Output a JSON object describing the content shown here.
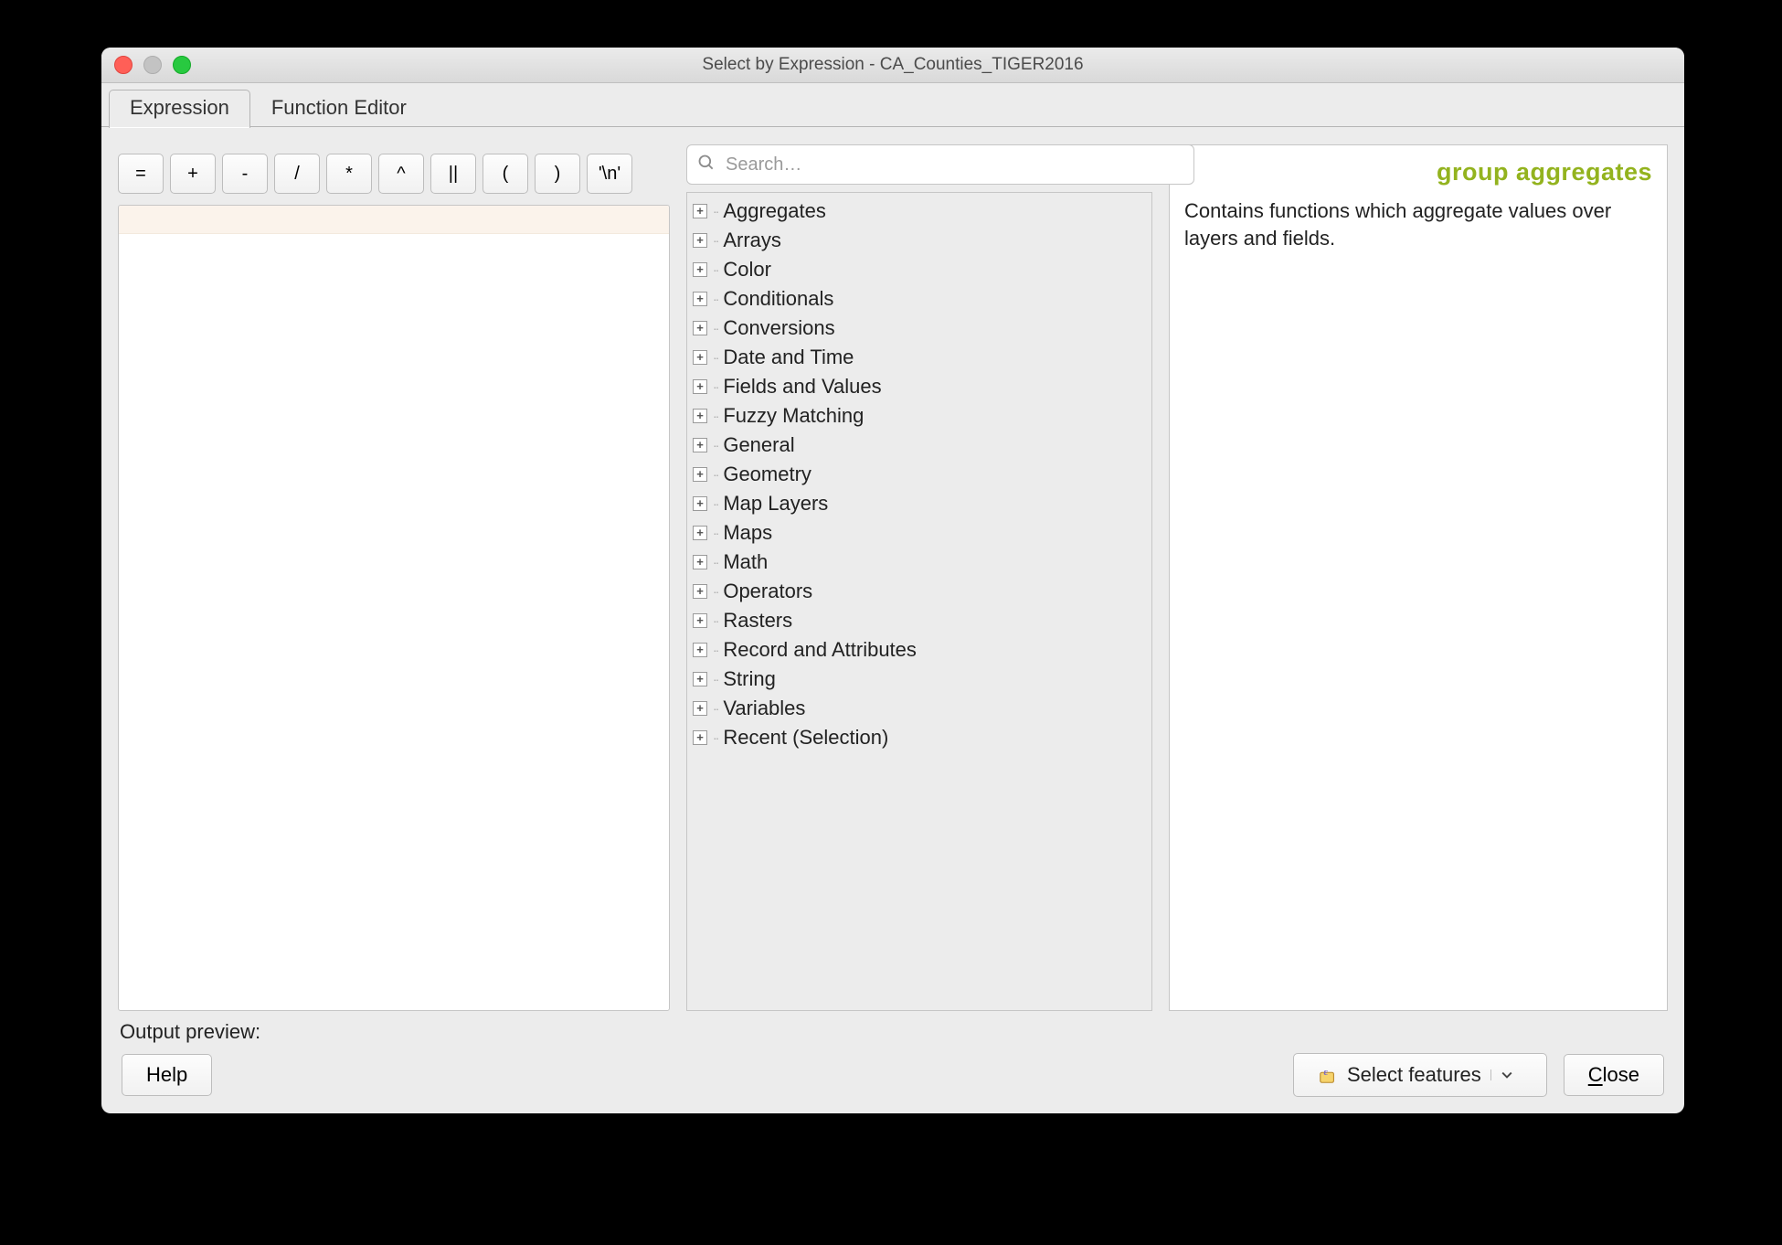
{
  "title": "Select by Expression - CA_Counties_TIGER2016",
  "tabs": {
    "expression": "Expression",
    "functionEditor": "Function Editor"
  },
  "operators": [
    "=",
    "+",
    "-",
    "/",
    "*",
    "^",
    "||",
    "(",
    ")",
    "'\\n'"
  ],
  "search": {
    "placeholder": "Search…",
    "value": ""
  },
  "categories": [
    "Aggregates",
    "Arrays",
    "Color",
    "Conditionals",
    "Conversions",
    "Date and Time",
    "Fields and Values",
    "Fuzzy Matching",
    "General",
    "Geometry",
    "Map Layers",
    "Maps",
    "Math",
    "Operators",
    "Rasters",
    "Record and Attributes",
    "String",
    "Variables",
    "Recent (Selection)"
  ],
  "help": {
    "title": "group aggregates",
    "body": "Contains functions which aggregate values over layers and fields."
  },
  "previewLabel": "Output preview:",
  "buttons": {
    "help": "Help",
    "select": "Select features",
    "close_prefix": "C",
    "close_rest": "lose"
  }
}
